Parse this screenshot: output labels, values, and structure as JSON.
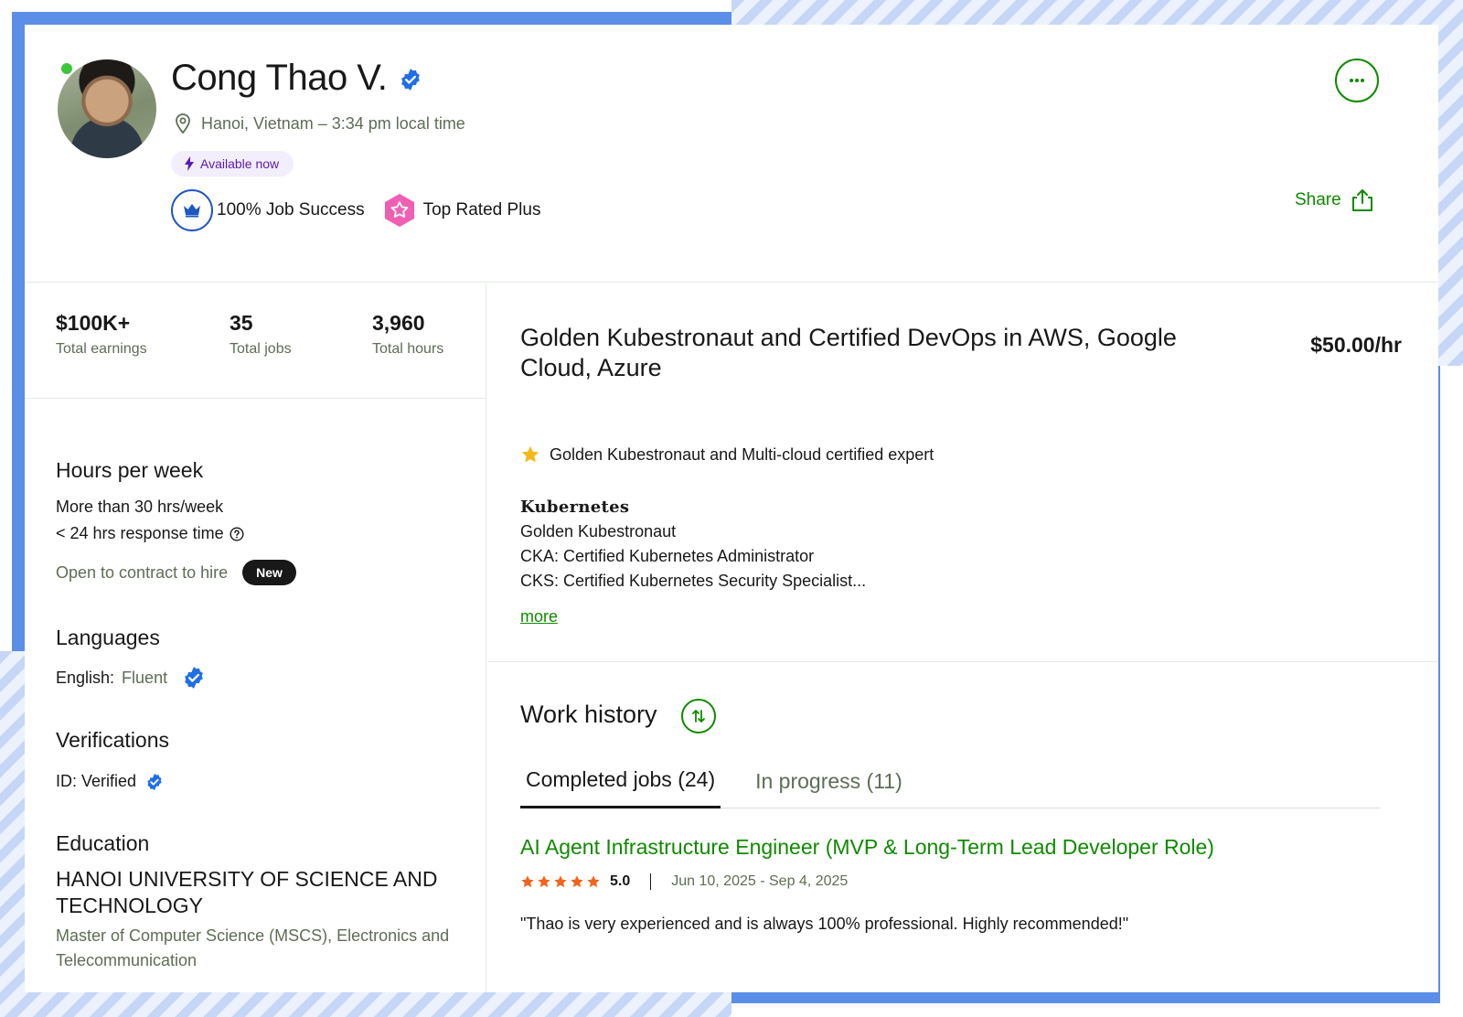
{
  "profile": {
    "name": "Cong Thao V.",
    "location": "Hanoi, Vietnam – 3:34 pm local time",
    "availability": "Available now",
    "job_success": "100% Job Success",
    "top_rated": "Top Rated Plus",
    "share_label": "Share"
  },
  "stats": [
    {
      "value": "$100K+",
      "label": "Total earnings"
    },
    {
      "value": "35",
      "label": "Total jobs"
    },
    {
      "value": "3,960",
      "label": "Total hours"
    }
  ],
  "hours": {
    "title": "Hours per week",
    "availability": "More than 30 hrs/week",
    "response": "< 24 hrs response time",
    "contract": "Open to contract to hire",
    "new_badge": "New"
  },
  "languages": {
    "title": "Languages",
    "name": "English:",
    "level": "Fluent"
  },
  "verifications": {
    "title": "Verifications",
    "id": "ID: Verified"
  },
  "education": {
    "title": "Education",
    "school": "HANOI UNIVERSITY OF SCIENCE AND TECHNOLOGY",
    "degree": "Master of Computer Science (MSCS), Electronics and Telecommunication"
  },
  "overview": {
    "headline": "Golden Kubestronaut and Certified DevOps in AWS, Google Cloud, Azure",
    "rate": "$50.00/hr",
    "tagline": "Golden Kubestronaut and Multi-cloud certified expert",
    "section": "Kubernetes",
    "lines": [
      "Golden Kubestronaut",
      "CKA: Certified Kubernetes Administrator",
      "CKS: Certified Kubernetes Security Specialist..."
    ],
    "more_label": "more"
  },
  "work_history": {
    "title": "Work history",
    "tabs": [
      "Completed jobs (24)",
      "In progress (11)"
    ],
    "job": {
      "title": "AI Agent Infrastructure Engineer (MVP & Long-Term Lead Developer Role)",
      "rating": "5.0",
      "dates": "Jun 10, 2025 - Sep 4, 2025",
      "feedback": "\"Thao is very experienced and is always 100% professional. Highly recommended!\""
    }
  },
  "colors": {
    "brand_green": "#108a00",
    "verified_blue": "#1f6ee6",
    "available_purple": "#5b1ab3",
    "star_orange": "#f0641e",
    "frame_blue": "#5b8ee6"
  }
}
